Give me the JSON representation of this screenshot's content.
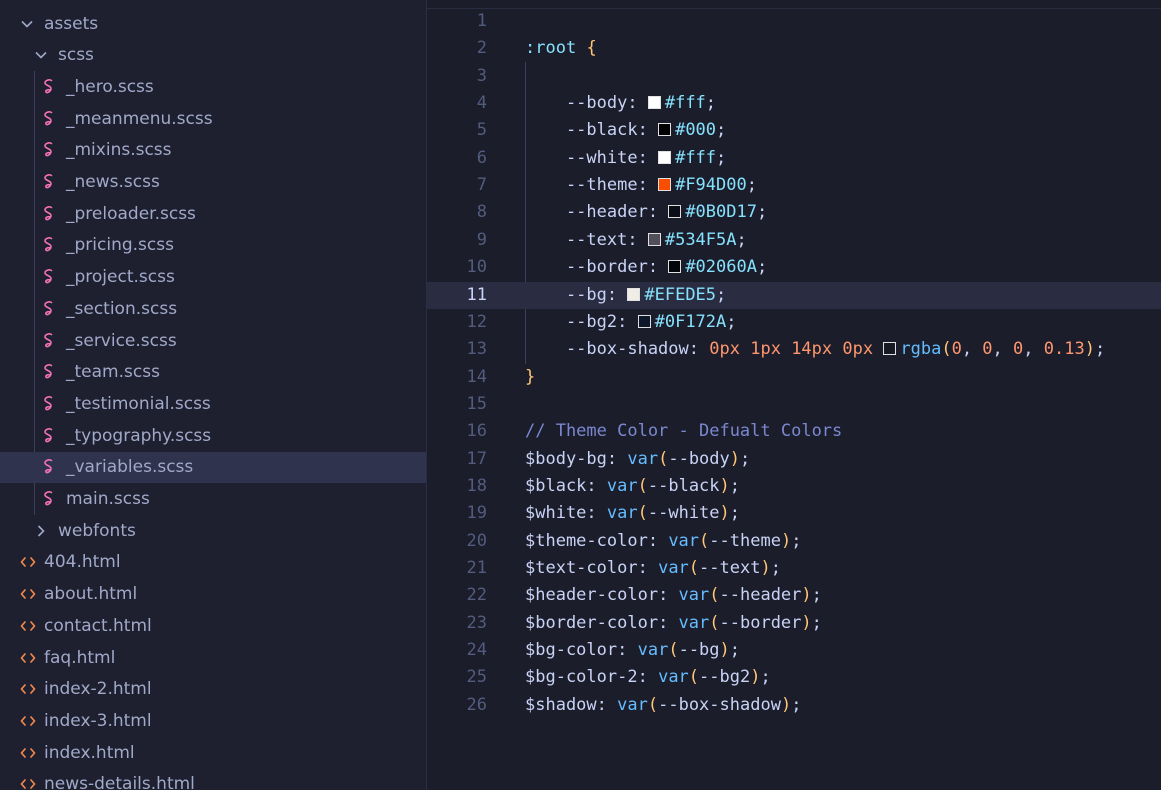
{
  "sidebar": {
    "items": [
      {
        "label": "assets",
        "kind": "folder",
        "expanded": true,
        "indent": 0
      },
      {
        "label": "scss",
        "kind": "folder",
        "expanded": true,
        "indent": 1
      },
      {
        "label": "_hero.scss",
        "kind": "scss",
        "indent": 2
      },
      {
        "label": "_meanmenu.scss",
        "kind": "scss",
        "indent": 2
      },
      {
        "label": "_mixins.scss",
        "kind": "scss",
        "indent": 2
      },
      {
        "label": "_news.scss",
        "kind": "scss",
        "indent": 2
      },
      {
        "label": "_preloader.scss",
        "kind": "scss",
        "indent": 2
      },
      {
        "label": "_pricing.scss",
        "kind": "scss",
        "indent": 2
      },
      {
        "label": "_project.scss",
        "kind": "scss",
        "indent": 2
      },
      {
        "label": "_section.scss",
        "kind": "scss",
        "indent": 2
      },
      {
        "label": "_service.scss",
        "kind": "scss",
        "indent": 2
      },
      {
        "label": "_team.scss",
        "kind": "scss",
        "indent": 2
      },
      {
        "label": "_testimonial.scss",
        "kind": "scss",
        "indent": 2
      },
      {
        "label": "_typography.scss",
        "kind": "scss",
        "indent": 2
      },
      {
        "label": "_variables.scss",
        "kind": "scss",
        "indent": 2,
        "selected": true
      },
      {
        "label": "main.scss",
        "kind": "scss",
        "indent": 2
      },
      {
        "label": "webfonts",
        "kind": "folder",
        "expanded": false,
        "indent": 1
      },
      {
        "label": "404.html",
        "kind": "html",
        "indent": 0
      },
      {
        "label": "about.html",
        "kind": "html",
        "indent": 0
      },
      {
        "label": "contact.html",
        "kind": "html",
        "indent": 0
      },
      {
        "label": "faq.html",
        "kind": "html",
        "indent": 0
      },
      {
        "label": "index-2.html",
        "kind": "html",
        "indent": 0
      },
      {
        "label": "index-3.html",
        "kind": "html",
        "indent": 0
      },
      {
        "label": "index.html",
        "kind": "html",
        "indent": 0
      },
      {
        "label": "news-details.html",
        "kind": "html",
        "indent": 0
      }
    ]
  },
  "editor": {
    "current_line": 11,
    "lines": [
      {
        "n": "1",
        "tokens": []
      },
      {
        "n": "2",
        "tokens": [
          {
            "t": ":root",
            "c": "sel"
          },
          {
            "t": " ",
            "c": "punc"
          },
          {
            "t": "{",
            "c": "brace"
          }
        ]
      },
      {
        "n": "3",
        "tokens": []
      },
      {
        "n": "4",
        "tokens": [
          {
            "t": "    --body",
            "c": "prop"
          },
          {
            "t": ": ",
            "c": "punc"
          },
          {
            "sw": "#fff"
          },
          {
            "t": "#fff",
            "c": "color"
          },
          {
            "t": ";",
            "c": "punc"
          }
        ]
      },
      {
        "n": "5",
        "tokens": [
          {
            "t": "    --black",
            "c": "prop"
          },
          {
            "t": ": ",
            "c": "punc"
          },
          {
            "sw": "#000"
          },
          {
            "t": "#000",
            "c": "color"
          },
          {
            "t": ";",
            "c": "punc"
          }
        ]
      },
      {
        "n": "6",
        "tokens": [
          {
            "t": "    --white",
            "c": "prop"
          },
          {
            "t": ": ",
            "c": "punc"
          },
          {
            "sw": "#fff"
          },
          {
            "t": "#fff",
            "c": "color"
          },
          {
            "t": ";",
            "c": "punc"
          }
        ]
      },
      {
        "n": "7",
        "tokens": [
          {
            "t": "    --theme",
            "c": "prop"
          },
          {
            "t": ": ",
            "c": "punc"
          },
          {
            "sw": "#F94D00"
          },
          {
            "t": "#F94D00",
            "c": "color"
          },
          {
            "t": ";",
            "c": "punc"
          }
        ]
      },
      {
        "n": "8",
        "tokens": [
          {
            "t": "    --header",
            "c": "prop"
          },
          {
            "t": ": ",
            "c": "punc"
          },
          {
            "sw": "#0B0D17"
          },
          {
            "t": "#0B0D17",
            "c": "color"
          },
          {
            "t": ";",
            "c": "punc"
          }
        ]
      },
      {
        "n": "9",
        "tokens": [
          {
            "t": "    --text",
            "c": "prop"
          },
          {
            "t": ": ",
            "c": "punc"
          },
          {
            "sw": "#534F5A"
          },
          {
            "t": "#534F5A",
            "c": "color"
          },
          {
            "t": ";",
            "c": "punc"
          }
        ]
      },
      {
        "n": "10",
        "tokens": [
          {
            "t": "    --border",
            "c": "prop"
          },
          {
            "t": ": ",
            "c": "punc"
          },
          {
            "sw": "#02060A"
          },
          {
            "t": "#02060A",
            "c": "color"
          },
          {
            "t": ";",
            "c": "punc"
          }
        ]
      },
      {
        "n": "11",
        "tokens": [
          {
            "t": "    --bg",
            "c": "prop"
          },
          {
            "t": ": ",
            "c": "punc"
          },
          {
            "sw": "#EFEDE5"
          },
          {
            "t": "#EFEDE5",
            "c": "color"
          },
          {
            "t": ";",
            "c": "punc"
          }
        ]
      },
      {
        "n": "12",
        "tokens": [
          {
            "t": "    --bg2",
            "c": "prop"
          },
          {
            "t": ": ",
            "c": "punc"
          },
          {
            "sw": "#0F172A"
          },
          {
            "t": "#0F172A",
            "c": "color"
          },
          {
            "t": ";",
            "c": "punc"
          }
        ]
      },
      {
        "n": "13",
        "tokens": [
          {
            "t": "    --box-shadow",
            "c": "prop"
          },
          {
            "t": ": ",
            "c": "punc"
          },
          {
            "t": "0px",
            "c": "num"
          },
          {
            "t": " ",
            "c": "punc"
          },
          {
            "t": "1px",
            "c": "num"
          },
          {
            "t": " ",
            "c": "punc"
          },
          {
            "t": "14px",
            "c": "num"
          },
          {
            "t": " ",
            "c": "punc"
          },
          {
            "t": "0px",
            "c": "num"
          },
          {
            "t": " ",
            "c": "punc"
          },
          {
            "sw": "rgba(0, 0, 0, 0.13)"
          },
          {
            "t": "rgba",
            "c": "fn"
          },
          {
            "t": "(",
            "c": "paren"
          },
          {
            "t": "0",
            "c": "num"
          },
          {
            "t": ", ",
            "c": "punc"
          },
          {
            "t": "0",
            "c": "num"
          },
          {
            "t": ", ",
            "c": "punc"
          },
          {
            "t": "0",
            "c": "num"
          },
          {
            "t": ", ",
            "c": "punc"
          },
          {
            "t": "0.13",
            "c": "num"
          },
          {
            "t": ")",
            "c": "paren"
          },
          {
            "t": ";",
            "c": "punc"
          }
        ]
      },
      {
        "n": "14",
        "tokens": [
          {
            "t": "}",
            "c": "brace"
          }
        ]
      },
      {
        "n": "15",
        "tokens": []
      },
      {
        "n": "16",
        "tokens": [
          {
            "t": "// Theme Color - Defualt Colors",
            "c": "comment"
          }
        ]
      },
      {
        "n": "17",
        "tokens": [
          {
            "t": "$body-bg",
            "c": "var"
          },
          {
            "t": ": ",
            "c": "punc"
          },
          {
            "t": "var",
            "c": "fn"
          },
          {
            "t": "(",
            "c": "paren"
          },
          {
            "t": "--body",
            "c": "prop"
          },
          {
            "t": ")",
            "c": "paren"
          },
          {
            "t": ";",
            "c": "punc"
          }
        ]
      },
      {
        "n": "18",
        "tokens": [
          {
            "t": "$black",
            "c": "var"
          },
          {
            "t": ": ",
            "c": "punc"
          },
          {
            "t": "var",
            "c": "fn"
          },
          {
            "t": "(",
            "c": "paren"
          },
          {
            "t": "--black",
            "c": "prop"
          },
          {
            "t": ")",
            "c": "paren"
          },
          {
            "t": ";",
            "c": "punc"
          }
        ]
      },
      {
        "n": "19",
        "tokens": [
          {
            "t": "$white",
            "c": "var"
          },
          {
            "t": ": ",
            "c": "punc"
          },
          {
            "t": "var",
            "c": "fn"
          },
          {
            "t": "(",
            "c": "paren"
          },
          {
            "t": "--white",
            "c": "prop"
          },
          {
            "t": ")",
            "c": "paren"
          },
          {
            "t": ";",
            "c": "punc"
          }
        ]
      },
      {
        "n": "20",
        "tokens": [
          {
            "t": "$theme-color",
            "c": "var"
          },
          {
            "t": ": ",
            "c": "punc"
          },
          {
            "t": "var",
            "c": "fn"
          },
          {
            "t": "(",
            "c": "paren"
          },
          {
            "t": "--theme",
            "c": "prop"
          },
          {
            "t": ")",
            "c": "paren"
          },
          {
            "t": ";",
            "c": "punc"
          }
        ]
      },
      {
        "n": "21",
        "tokens": [
          {
            "t": "$text-color",
            "c": "var"
          },
          {
            "t": ": ",
            "c": "punc"
          },
          {
            "t": "var",
            "c": "fn"
          },
          {
            "t": "(",
            "c": "paren"
          },
          {
            "t": "--text",
            "c": "prop"
          },
          {
            "t": ")",
            "c": "paren"
          },
          {
            "t": ";",
            "c": "punc"
          }
        ]
      },
      {
        "n": "22",
        "tokens": [
          {
            "t": "$header-color",
            "c": "var"
          },
          {
            "t": ": ",
            "c": "punc"
          },
          {
            "t": "var",
            "c": "fn"
          },
          {
            "t": "(",
            "c": "paren"
          },
          {
            "t": "--header",
            "c": "prop"
          },
          {
            "t": ")",
            "c": "paren"
          },
          {
            "t": ";",
            "c": "punc"
          }
        ]
      },
      {
        "n": "23",
        "tokens": [
          {
            "t": "$border-color",
            "c": "var"
          },
          {
            "t": ": ",
            "c": "punc"
          },
          {
            "t": "var",
            "c": "fn"
          },
          {
            "t": "(",
            "c": "paren"
          },
          {
            "t": "--border",
            "c": "prop"
          },
          {
            "t": ")",
            "c": "paren"
          },
          {
            "t": ";",
            "c": "punc"
          }
        ]
      },
      {
        "n": "24",
        "tokens": [
          {
            "t": "$bg-color",
            "c": "var"
          },
          {
            "t": ": ",
            "c": "punc"
          },
          {
            "t": "var",
            "c": "fn"
          },
          {
            "t": "(",
            "c": "paren"
          },
          {
            "t": "--bg",
            "c": "prop"
          },
          {
            "t": ")",
            "c": "paren"
          },
          {
            "t": ";",
            "c": "punc"
          }
        ]
      },
      {
        "n": "25",
        "tokens": [
          {
            "t": "$bg-color-2",
            "c": "var"
          },
          {
            "t": ": ",
            "c": "punc"
          },
          {
            "t": "var",
            "c": "fn"
          },
          {
            "t": "(",
            "c": "paren"
          },
          {
            "t": "--bg2",
            "c": "prop"
          },
          {
            "t": ")",
            "c": "paren"
          },
          {
            "t": ";",
            "c": "punc"
          }
        ]
      },
      {
        "n": "26",
        "tokens": [
          {
            "t": "$shadow",
            "c": "var"
          },
          {
            "t": ": ",
            "c": "punc"
          },
          {
            "t": "var",
            "c": "fn"
          },
          {
            "t": "(",
            "c": "paren"
          },
          {
            "t": "--box-shadow",
            "c": "prop"
          },
          {
            "t": ")",
            "c": "paren"
          },
          {
            "t": ";",
            "c": "punc"
          }
        ]
      }
    ]
  },
  "icons": {
    "folder_open": "chevron-down-icon",
    "folder_closed": "chevron-right-icon",
    "scss": "sass-icon",
    "html": "code-icon"
  },
  "colors": {
    "scss_icon": "#f472b6",
    "html_icon": "#f2884b",
    "selection": "#2f334d"
  }
}
